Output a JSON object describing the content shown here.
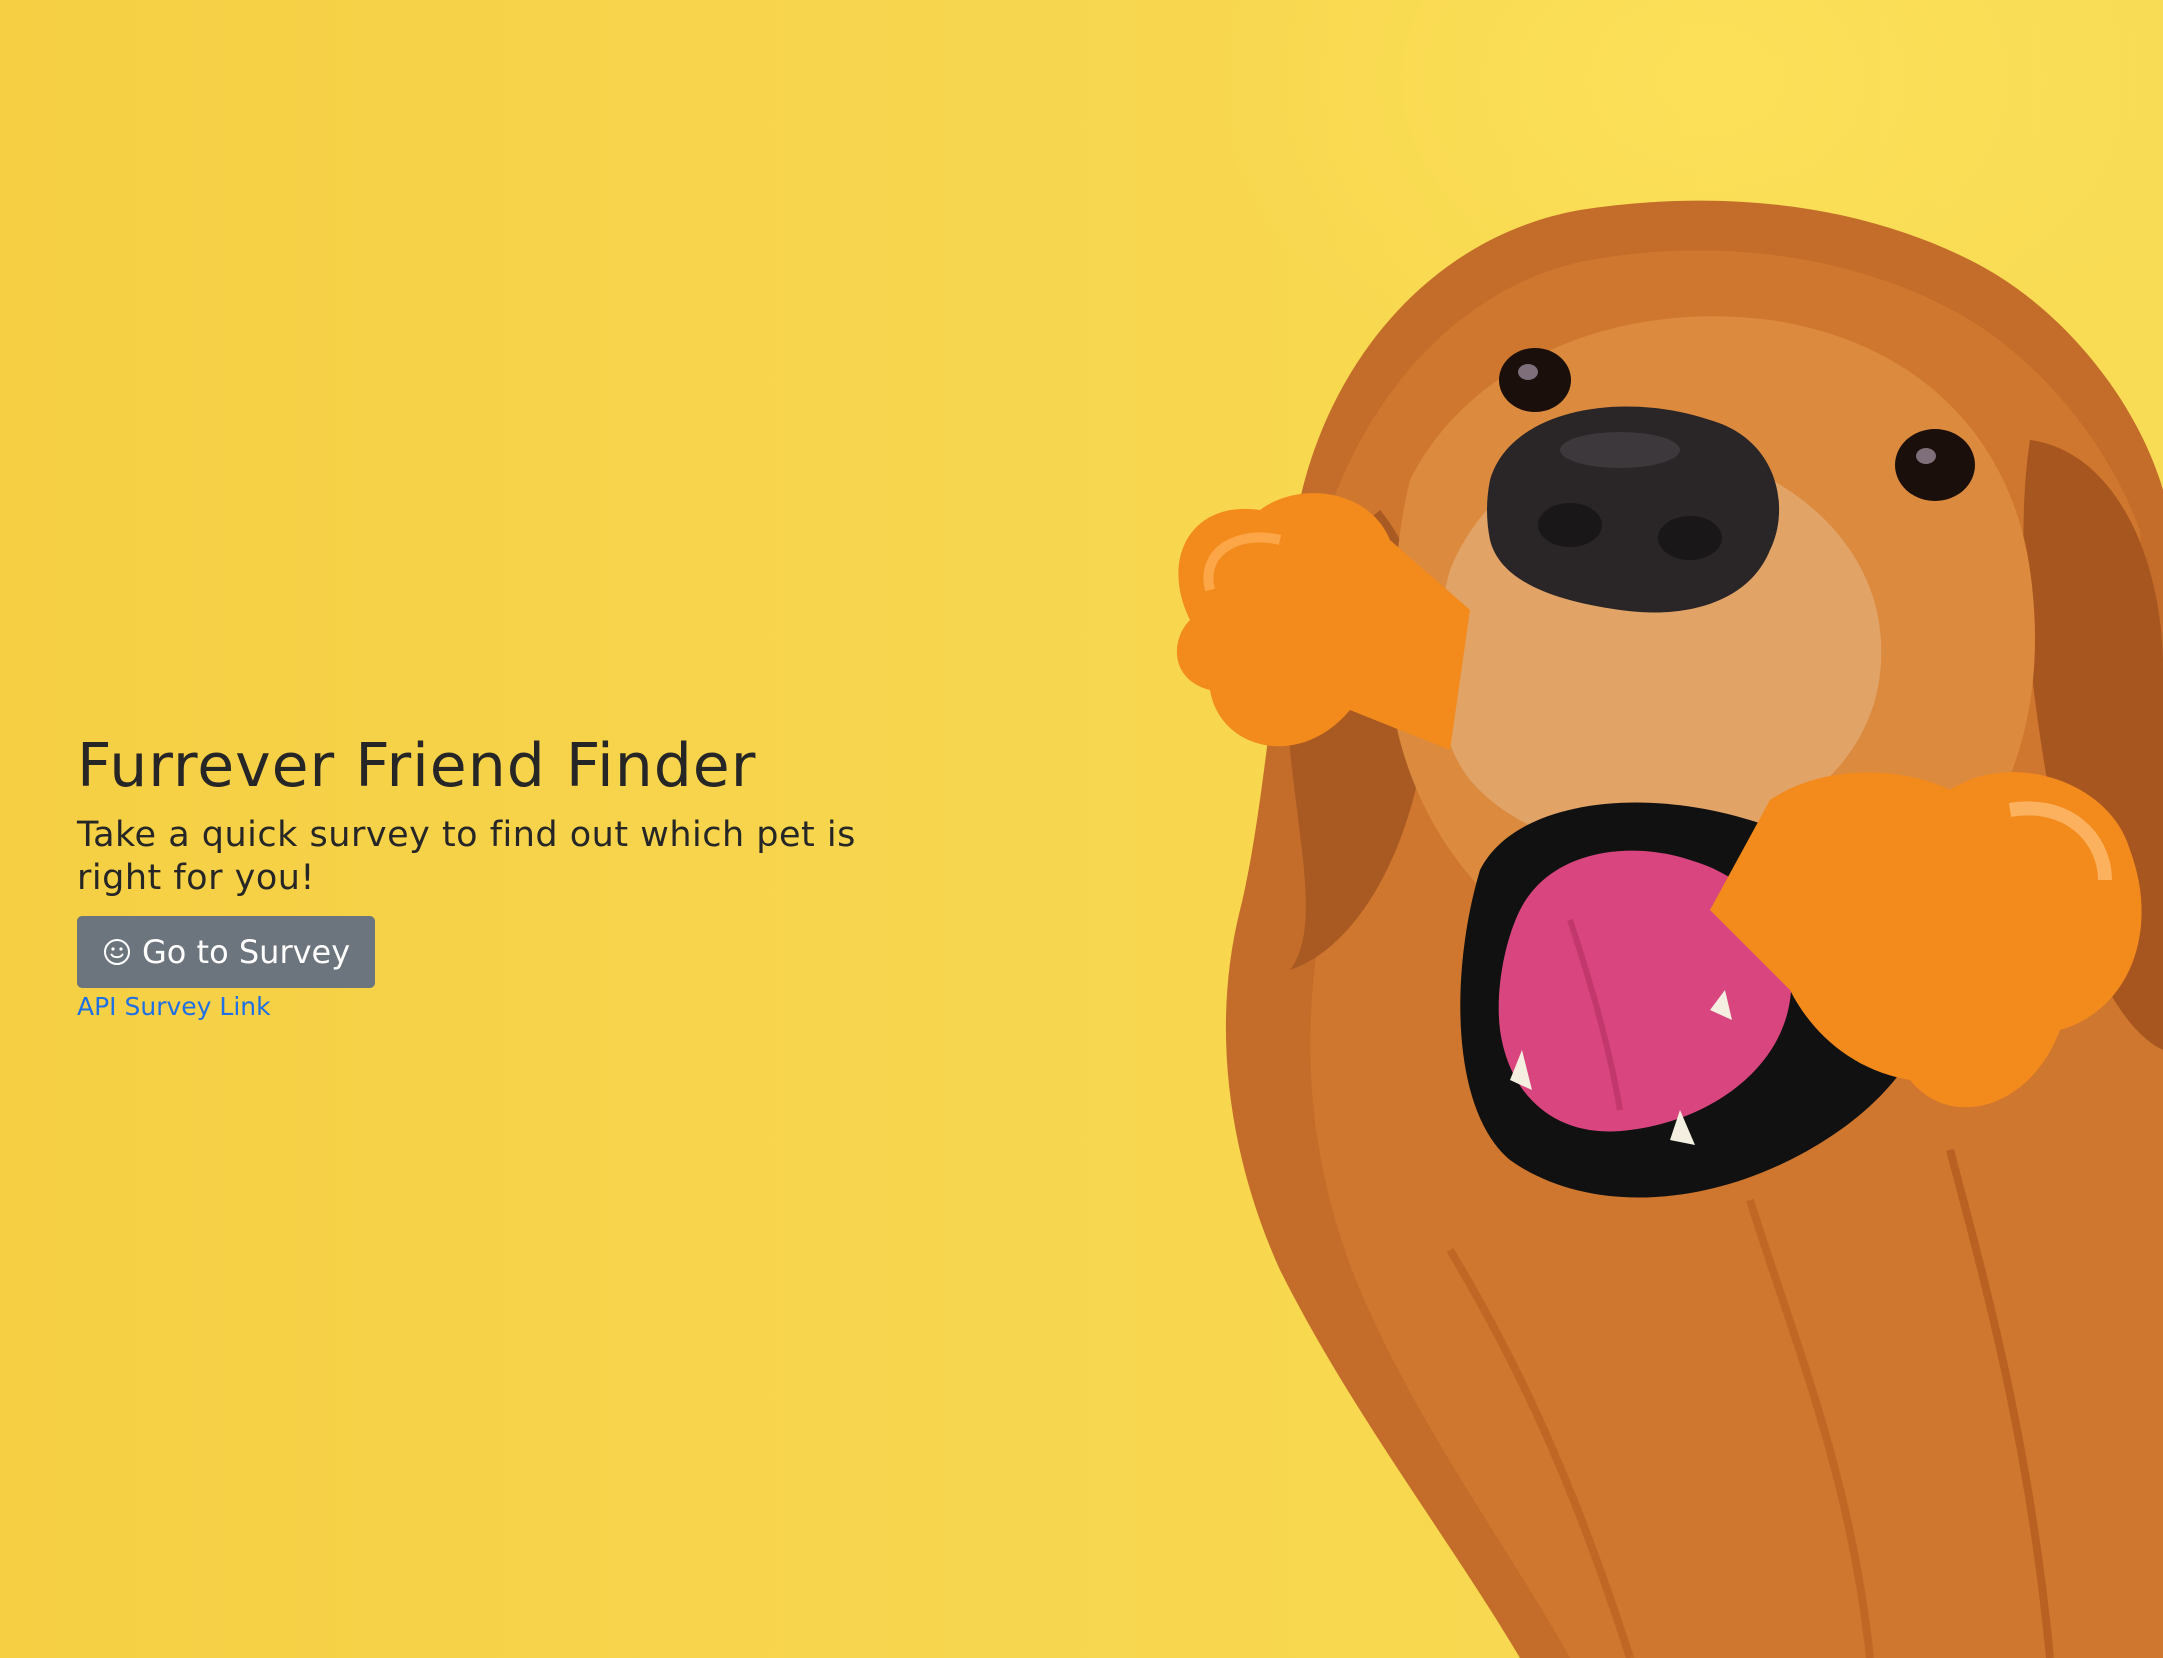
{
  "hero": {
    "title": "Furrever Friend Finder",
    "subtitle": "Take a quick survey to find out which pet is right for you!",
    "button_label": "Go to Survey",
    "button_icon": "smiley-icon",
    "link_text": "API Survey Link"
  },
  "colors": {
    "background": "#f6d247",
    "button": "#6c757d",
    "link": "#1f6fe5",
    "text": "#262626"
  }
}
